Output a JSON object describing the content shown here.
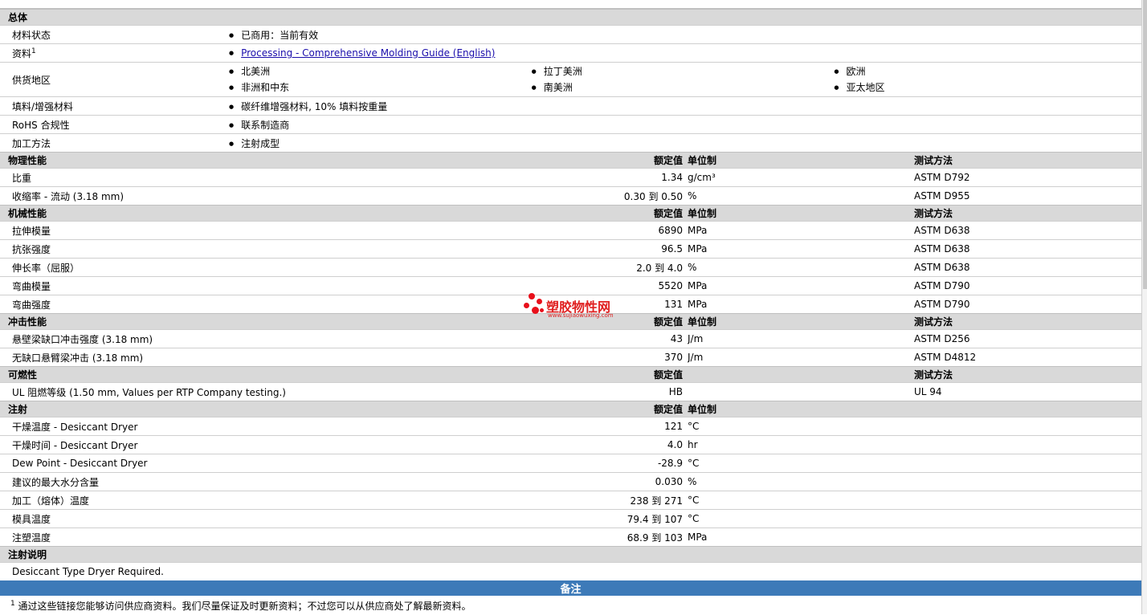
{
  "general": {
    "title": "总体",
    "rows": [
      {
        "label": "材料状态",
        "value": "已商用：当前有效"
      },
      {
        "label": "资料",
        "sup": "1",
        "link": "Processing - Comprehensive Molding Guide (English)"
      },
      {
        "label": "供货地区",
        "regions": [
          [
            "北美洲",
            "非洲和中东"
          ],
          [
            "拉丁美洲",
            "南美洲"
          ],
          [
            "欧洲",
            "亚太地区"
          ]
        ]
      },
      {
        "label": "填料/增强材料",
        "value": "碳纤维增强材料, 10% 填料按重量"
      },
      {
        "label": "RoHS 合规性",
        "value": "联系制造商"
      },
      {
        "label": "加工方法",
        "value": "注射成型"
      }
    ]
  },
  "columns": {
    "nominal": "额定值",
    "units": "单位制",
    "method": "测试方法"
  },
  "sections": [
    {
      "title": "物理性能",
      "units_header": true,
      "method_header": true,
      "rows": [
        {
          "label": "比重",
          "value": "1.34",
          "unit": "g/cm³",
          "method": "ASTM D792"
        },
        {
          "label": "收缩率  - 流动  (3.18 mm)",
          "value": "0.30 到  0.50",
          "unit": "%",
          "method": "ASTM D955"
        }
      ]
    },
    {
      "title": "机械性能",
      "units_header": true,
      "method_header": true,
      "rows": [
        {
          "label": "拉伸模量",
          "value": "6890",
          "unit": "MPa",
          "method": "ASTM D638"
        },
        {
          "label": "抗张强度",
          "value": "96.5",
          "unit": "MPa",
          "method": "ASTM D638"
        },
        {
          "label": "伸长率（屈服）",
          "value": "2.0 到  4.0",
          "unit": "%",
          "method": "ASTM D638"
        },
        {
          "label": "弯曲模量",
          "value": "5520",
          "unit": "MPa",
          "method": "ASTM D790"
        },
        {
          "label": "弯曲强度",
          "value": "131",
          "unit": "MPa",
          "method": "ASTM D790"
        }
      ]
    },
    {
      "title": "冲击性能",
      "units_header": true,
      "method_header": true,
      "rows": [
        {
          "label": "悬壁梁缺口冲击强度  (3.18 mm)",
          "value": "43",
          "unit": "J/m",
          "method": "ASTM D256"
        },
        {
          "label": "无缺口悬臂梁冲击  (3.18 mm)",
          "value": "370",
          "unit": "J/m",
          "method": "ASTM D4812"
        }
      ]
    },
    {
      "title": "可燃性",
      "units_header": false,
      "method_header": true,
      "rows": [
        {
          "label": "UL 阻燃等级  (1.50 mm, Values per RTP Company testing.)",
          "value": "HB",
          "unit": "",
          "method": "UL 94"
        }
      ]
    },
    {
      "title": "注射",
      "units_header": true,
      "method_header": false,
      "rows": [
        {
          "label": "干燥温度  - Desiccant Dryer",
          "value": "121",
          "unit": "°C",
          "method": ""
        },
        {
          "label": "干燥时间  - Desiccant Dryer",
          "value": "4.0",
          "unit": "hr",
          "method": ""
        },
        {
          "label": "Dew Point - Desiccant Dryer",
          "value": "-28.9",
          "unit": "°C",
          "method": ""
        },
        {
          "label": "建议的最大水分含量",
          "value": "0.030",
          "unit": "%",
          "method": ""
        },
        {
          "label": "加工（熔体）温度",
          "value": "238 到  271",
          "unit": "°C",
          "method": ""
        },
        {
          "label": "模具温度",
          "value": "79.4 到  107",
          "unit": "°C",
          "method": ""
        },
        {
          "label": "注塑温度",
          "value": "68.9 到  103",
          "unit": "MPa",
          "method": ""
        }
      ]
    }
  ],
  "injection_notes": {
    "title": "注射说明",
    "text": "Desiccant Type Dryer Required."
  },
  "notes_bar": "备注",
  "footnote": {
    "sup": "1",
    "text": " 通过这些链接您能够访问供应商资料。我们尽量保证及时更新资料；不过您可以从供应商处了解最新资料。"
  },
  "watermark": {
    "name": "塑胶物性网",
    "url": "www.sujiaowuxing.com",
    "color": "#e8101b"
  }
}
